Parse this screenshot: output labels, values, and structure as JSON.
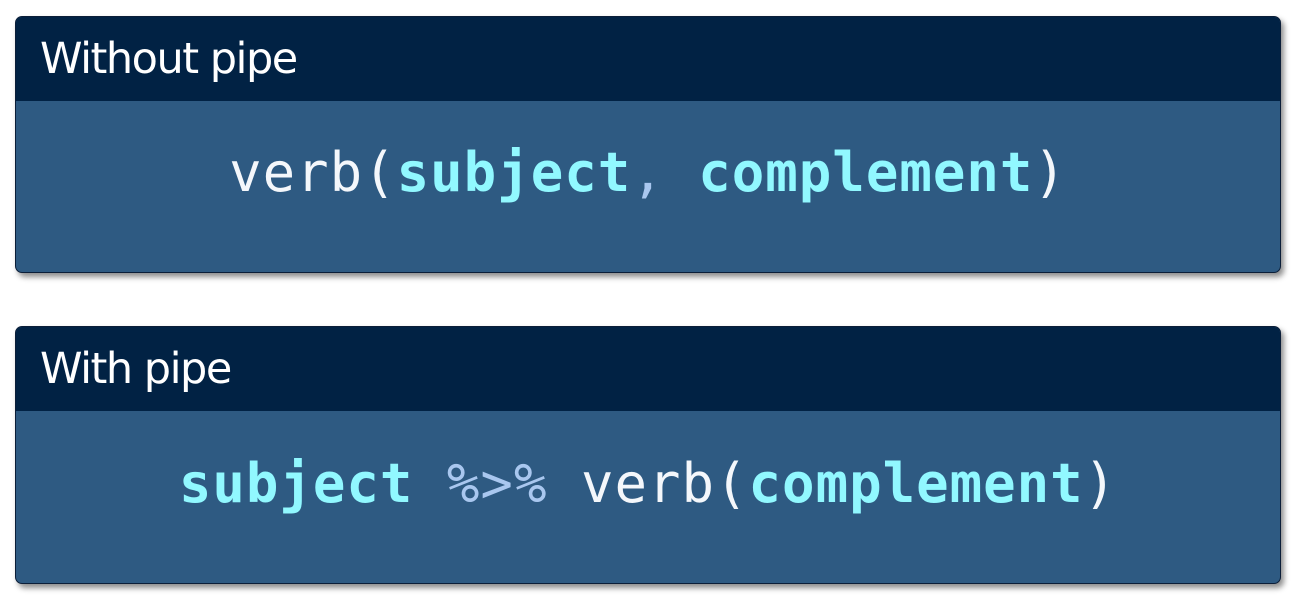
{
  "colors": {
    "header_bg": "#012244",
    "body_bg": "#2e5a82",
    "plain_text": "#f4f7fb",
    "argument_text": "#91f8ff",
    "operator_text": "#a9c7ef"
  },
  "without_pipe": {
    "title": "Without pipe",
    "code": {
      "verb": "verb",
      "open_paren": "(",
      "subject": "subject",
      "comma": ",",
      "space": " ",
      "complement": "complement",
      "close_paren": ")"
    }
  },
  "with_pipe": {
    "title": "With pipe",
    "code": {
      "subject": "subject",
      "space1": " ",
      "pipe": "%>%",
      "space2": " ",
      "verb": "verb",
      "open_paren": "(",
      "complement": "complement",
      "close_paren": ")"
    }
  }
}
